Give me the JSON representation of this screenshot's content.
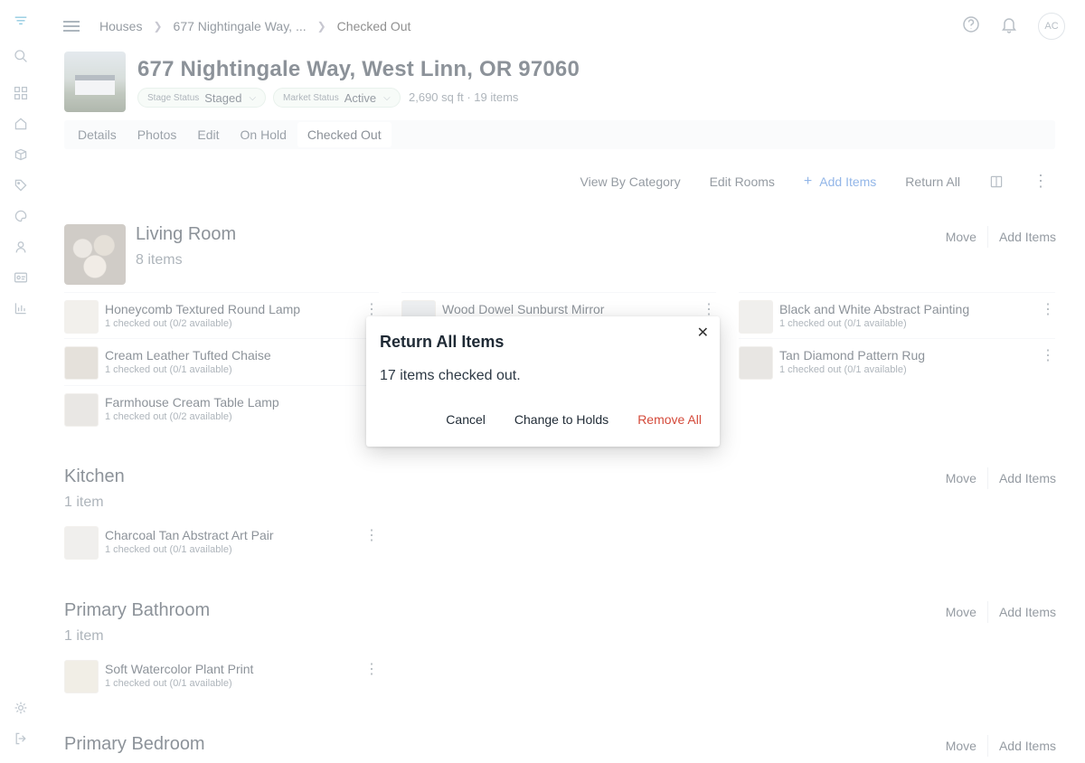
{
  "breadcrumb": {
    "root": "Houses",
    "property": "677 Nightingale Way, ...",
    "current": "Checked Out"
  },
  "user": {
    "initials": "AC"
  },
  "property": {
    "title": "677 Nightingale Way, West Linn, OR 97060",
    "stage_status_label": "Stage Status",
    "stage_status_value": "Staged",
    "market_status_label": "Market Status",
    "market_status_value": "Active",
    "summary": "2,690 sq ft · 19 items"
  },
  "tabs": [
    "Details",
    "Photos",
    "Edit",
    "On Hold",
    "Checked Out"
  ],
  "toolbar": {
    "view_by_category": "View By Category",
    "edit_rooms": "Edit Rooms",
    "add_items": "Add Items",
    "return_all": "Return All"
  },
  "room_actions": {
    "move": "Move",
    "add_items": "Add Items"
  },
  "rooms": [
    {
      "title": "Living Room",
      "count": "8 items",
      "items": [
        {
          "name": "Honeycomb Textured Round Lamp",
          "sub": "1 checked out (0/2 available)"
        },
        {
          "name": "Wood Dowel Sunburst Mirror",
          "sub": ""
        },
        {
          "name": "Black and White Abstract Painting",
          "sub": "1 checked out (0/1 available)"
        },
        {
          "name": "Cream Leather Tufted Chaise",
          "sub": "1 checked out (0/1 available)"
        },
        {
          "name": "Tan Diamond Pattern Rug",
          "sub": "1 checked out (0/1 available)"
        },
        {
          "name": "Farmhouse Cream Table Lamp",
          "sub": "1 checked out (0/2 available)"
        }
      ]
    },
    {
      "title": "Kitchen",
      "count": "1 item",
      "items": [
        {
          "name": "Charcoal Tan Abstract Art Pair",
          "sub": "1 checked out (0/1 available)"
        }
      ]
    },
    {
      "title": "Primary Bathroom",
      "count": "1 item",
      "items": [
        {
          "name": "Soft Watercolor Plant Print",
          "sub": "1 checked out (0/1 available)"
        }
      ]
    },
    {
      "title": "Primary Bedroom"
    }
  ],
  "dialog": {
    "title": "Return All Items",
    "body": "17 items checked out.",
    "cancel": "Cancel",
    "change_to_holds": "Change to Holds",
    "remove_all": "Remove All"
  },
  "icons": [
    "cloud-logo-icon",
    "search-icon",
    "grid-icon",
    "home-icon",
    "box-icon",
    "tag-icon",
    "palette-icon",
    "person-icon",
    "id-card-icon",
    "chart-icon",
    "gear-icon",
    "logout-icon",
    "help-icon",
    "bell-icon",
    "columns-icon",
    "more-vertical-icon",
    "close-icon"
  ],
  "colors": {
    "accent": "#3a7bd5",
    "danger": "#d44a3a",
    "status_bg": "#f1f8f3"
  }
}
